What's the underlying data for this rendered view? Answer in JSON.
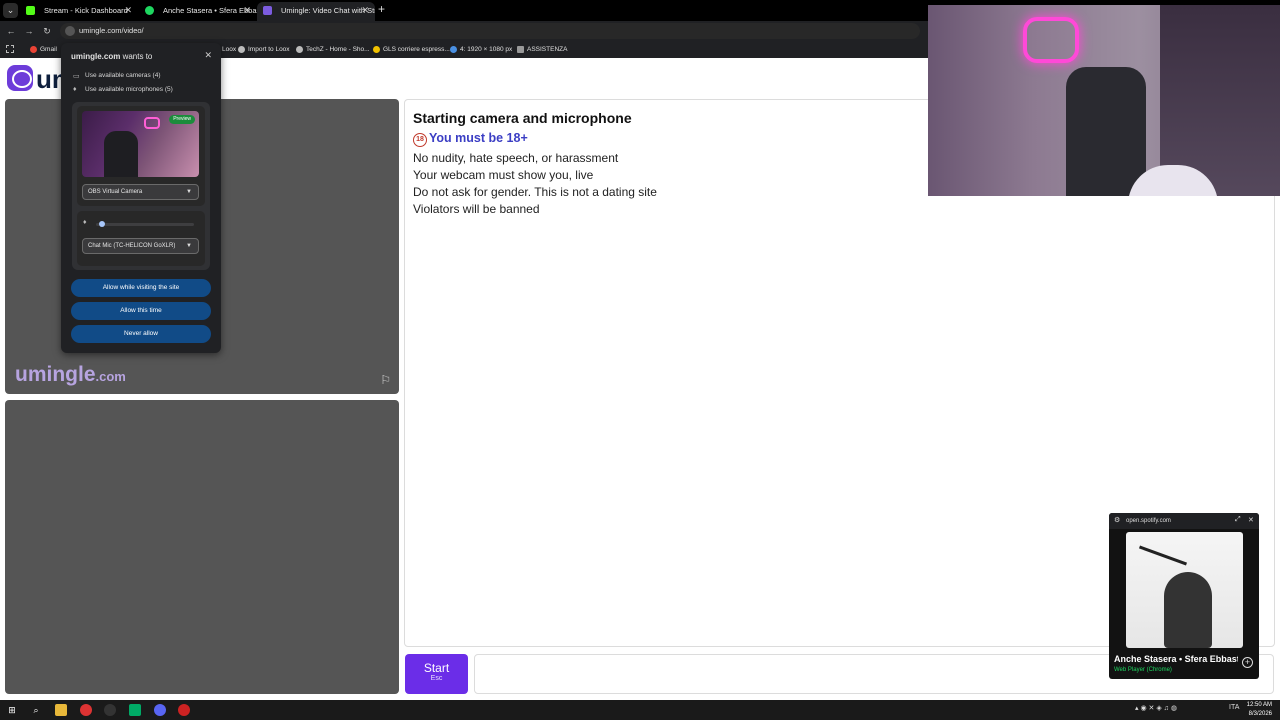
{
  "browser": {
    "tabs": [
      {
        "title": "Stream - Kick Dashboard",
        "favicon_color": "#53fc18",
        "active": false
      },
      {
        "title": "Anche Stasera • Sfera Ebbasta",
        "favicon_color": "#1ed760",
        "active": false
      },
      {
        "title": "Umingle: Video Chat with Strangers",
        "favicon_color": "#7c5ce0",
        "active": true
      }
    ],
    "new_tab": "+",
    "url": "umingle.com/video/",
    "bookmarks": [
      "Gmail",
      "Loox",
      "Import to Loox",
      "TechZ - Home - Sho...",
      "GLS corriere espress...",
      "4: 1920 × 1080 px",
      "ASSISTENZA"
    ]
  },
  "permission": {
    "site": "umingle.com",
    "wants_to": "wants to",
    "cameras": "Use available cameras (4)",
    "microphones": "Use available microphones (5)",
    "preview_label": "Preview",
    "camera_select": "OBS Virtual Camera",
    "mic_select": "Chat Mic (TC-HELICON GoXLR)",
    "mic_level": 0.03,
    "buttons": [
      "Allow while visiting the site",
      "Allow this time",
      "Never allow"
    ]
  },
  "site": {
    "logo": "umingle",
    "brand": "umingle",
    "brand_tld": ".com",
    "chat": {
      "title": "Starting camera and microphone",
      "age_badge": "18",
      "age_rule": "You must be 18+",
      "rules": [
        "No nudity, hate speech, or harassment",
        "Your webcam must show you, live",
        "Do not ask for gender. This is not a dating site",
        "Violators will be banned"
      ]
    },
    "start_label": "Start",
    "start_shortcut": "Esc"
  },
  "spotify": {
    "url": "open.spotify.com",
    "title": "Anche Stasera • Sfera Ebbasta",
    "source": "Web Player (Chrome)"
  },
  "taskbar": {
    "language": "ITA",
    "time": "12:50 AM",
    "date": "8/3/2026"
  }
}
